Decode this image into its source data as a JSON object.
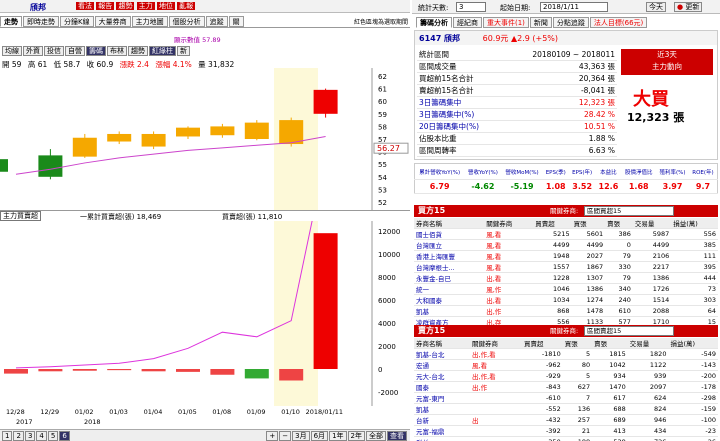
{
  "stock": {
    "code": "6147",
    "name": "頎邦",
    "price": "60.9元",
    "change": "▲2.9 (+5%)"
  },
  "left_menu": [
    "看法",
    "報告",
    "趨勢",
    "主力",
    "地位",
    "亂報"
  ],
  "top_tabs": [
    "走勢",
    "即時走勢",
    "分鐘K線",
    "大量券商",
    "主力地圖",
    "個股分析",
    "追蹤",
    "關"
  ],
  "top_right_note": "紅色區塊為選取期間",
  "chart_btns": [
    "均線",
    "外資",
    "投信",
    "自營",
    "籌碼",
    "布林",
    "趨勢",
    "紅綠柱",
    "新"
  ],
  "ohlc": {
    "open": "開 59",
    "high": "高 61",
    "low": "低 58.7",
    "close": "收 60.9",
    "chg": "漲跌 2.4",
    "pct": "漲幅 4.1%",
    "vol": "量 31,832"
  },
  "hint": "顯示數值 57.89",
  "main_chart": {
    "yticks": [
      "62",
      "61",
      "60",
      "59",
      "58",
      "57",
      "56",
      "55",
      "54",
      "53",
      "52"
    ],
    "last": "56.27",
    "dates": [
      "12/28",
      "12/29",
      "01/02",
      "01/03",
      "01/04",
      "01/05",
      "01/08",
      "01/09",
      "01/10",
      "2018/01/11"
    ],
    "years": [
      "2017",
      "2018"
    ]
  },
  "candles": [
    {
      "d": "12/28",
      "o": 55.4,
      "c": 54.4,
      "h": 55.6,
      "l": 54.0
    },
    {
      "d": "12/29",
      "o": 55.7,
      "c": 54.0,
      "h": 56.2,
      "l": 53.8
    },
    {
      "d": "01/02",
      "o": 55.6,
      "c": 57.1,
      "h": 57.4,
      "l": 55.5
    },
    {
      "d": "01/03",
      "o": 56.8,
      "c": 57.4,
      "h": 57.6,
      "l": 56.6
    },
    {
      "d": "01/04",
      "o": 56.4,
      "c": 57.4,
      "h": 57.6,
      "l": 56.2
    },
    {
      "d": "01/05",
      "o": 57.2,
      "c": 57.9,
      "h": 58.0,
      "l": 57.0
    },
    {
      "d": "01/08",
      "o": 57.3,
      "c": 58.0,
      "h": 58.2,
      "l": 57.1
    },
    {
      "d": "01/09",
      "o": 57.0,
      "c": 58.3,
      "h": 58.5,
      "l": 56.9
    },
    {
      "d": "01/10",
      "o": 56.6,
      "c": 58.5,
      "h": 58.7,
      "l": 56.4
    },
    {
      "d": "2018/01/11",
      "o": 59.0,
      "c": 60.9,
      "h": 61.0,
      "l": 58.7
    }
  ],
  "net_chart": {
    "legend1": "主力買賣超",
    "legend2": "一累計買賣超(張) 18,469",
    "legend3": "買賣超(張) 11,810",
    "yticks": [
      "12000",
      "10000",
      "8000",
      "6000",
      "4000",
      "2000",
      "0",
      "-2000"
    ],
    "bars": [
      -400,
      -200,
      -150,
      -100,
      -200,
      -250,
      -500,
      -820,
      -1000,
      11810
    ],
    "cum": [
      100,
      200,
      350,
      500,
      900,
      1800,
      3200,
      2800,
      4200,
      18469
    ]
  },
  "bottom": {
    "pages": [
      "1",
      "2",
      "3",
      "4",
      "5",
      "6"
    ],
    "periods": [
      "3月",
      "6月",
      "1年",
      "2年",
      "全部",
      "查看"
    ]
  },
  "stats_bar": {
    "label": "統計天數:",
    "days": "3",
    "label2": "起始日期:",
    "date": "2018/1/11",
    "today": "今天",
    "refresh": "更新"
  },
  "right_tabs": [
    "籌碼分析",
    "經紀商",
    "重大事件(1)",
    "新聞",
    "分點追蹤",
    "法人目標(66元)"
  ],
  "stats": {
    "head": "6147  頎邦",
    "head2": "60.9元  ▲2.9 (+5%)",
    "rows": [
      [
        "統計區間",
        "20180109 ~ 2018011"
      ],
      [
        "區間成交量",
        "43,363 張"
      ],
      [
        "買超前15名合計",
        "20,364 張"
      ],
      [
        "賣超前15名合計",
        "-8,041 張"
      ],
      [
        "3日籌碼集中",
        "12,323 張"
      ],
      [
        "3日籌碼集中(%)",
        "28.42 %"
      ],
      [
        "20日籌碼集中(%)",
        "10.51 %"
      ],
      [
        "佔股本比重",
        "1.88 %"
      ],
      [
        "區間周轉率",
        "6.63 %"
      ]
    ],
    "badge_title": "近3天",
    "badge_sub": "主力動向",
    "big": "大買",
    "big_val": "12,323 張"
  },
  "metrics": {
    "heads": [
      "累計營收YoY(%)",
      "營收YoY(%)",
      "營收MoM(%)",
      "EPS(季)",
      "EPS(年)",
      "本益比",
      "股價淨值比",
      "殖利率(%)",
      "ROE(年)"
    ],
    "vals": [
      "6.79",
      "-4.62",
      "-5.19",
      "1.08",
      "3.52",
      "12.6",
      "1.68",
      "3.97",
      "9.7"
    ]
  },
  "buy_panel": {
    "title": "買方15",
    "link": "關鍵券商:",
    "select": "區間買超15",
    "cols": [
      "券商名稱",
      "關鍵券商",
      "買賣超",
      "買張",
      "賣張",
      "交易量",
      "損益(萬)"
    ],
    "rows": [
      [
        "國士佰貨",
        "風,看",
        "5215",
        "5601",
        "386",
        "5987",
        "556"
      ],
      [
        "台灣匯立",
        "風,看",
        "4499",
        "4499",
        "0",
        "4499",
        "385"
      ],
      [
        "香港上海匯豐",
        "風,看",
        "1948",
        "2027",
        "79",
        "2106",
        "111"
      ],
      [
        "台灣摩根士...",
        "風,看",
        "1557",
        "1867",
        "330",
        "2217",
        "395"
      ],
      [
        "永豐金-自已",
        "出,看",
        "1228",
        "1307",
        "79",
        "1386",
        "444"
      ],
      [
        "統一",
        "風,作",
        "1046",
        "1386",
        "340",
        "1726",
        "73"
      ],
      [
        "大和國泰",
        "出,看",
        "1034",
        "1274",
        "240",
        "1514",
        "303"
      ],
      [
        "凱基",
        "出,作",
        "868",
        "1478",
        "610",
        "2088",
        "64"
      ],
      [
        "凌群資產方",
        "出,存",
        "556",
        "1133",
        "577",
        "1710",
        "15"
      ]
    ]
  },
  "sell_panel": {
    "title": "賣方15",
    "link": "關鍵券商:",
    "select": "區間賣超15",
    "cols": [
      "券商名稱",
      "關鍵券商",
      "買賣超",
      "買張",
      "賣張",
      "交易量",
      "損益(萬)"
    ],
    "rows": [
      [
        "凱基-台北",
        "出,作,看",
        "-1810",
        "5",
        "1815",
        "1820",
        "-549"
      ],
      [
        "宏通",
        "風,看",
        "-962",
        "80",
        "1042",
        "1122",
        "-143"
      ],
      [
        "元大-台北",
        "出,作,看",
        "-929",
        "5",
        "934",
        "939",
        "-200"
      ],
      [
        "國泰",
        "出,作",
        "-843",
        "627",
        "1470",
        "2097",
        "-178"
      ],
      [
        "元富-東門",
        "",
        "-610",
        "7",
        "617",
        "624",
        "-298"
      ],
      [
        "凱基",
        "",
        "-552",
        "136",
        "688",
        "824",
        "-159"
      ],
      [
        "台新",
        "出",
        "-432",
        "257",
        "689",
        "946",
        "-100"
      ],
      [
        "元富-福鼎",
        "",
        "-392",
        "21",
        "413",
        "434",
        "-23"
      ],
      [
        "群益",
        "",
        "-350",
        "188",
        "538",
        "726",
        "-26"
      ]
    ]
  }
}
